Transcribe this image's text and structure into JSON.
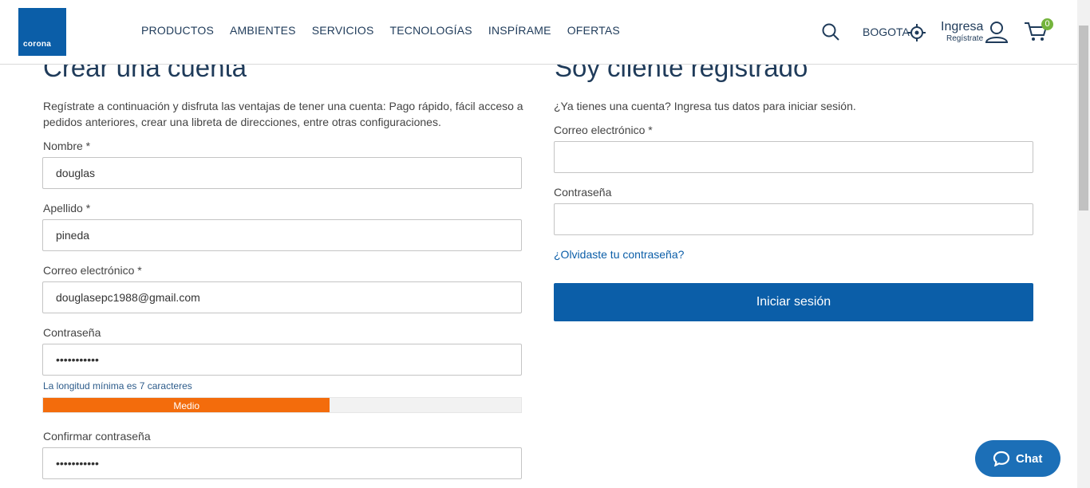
{
  "header": {
    "logo_text": "corona",
    "nav": [
      "PRODUCTOS",
      "AMBIENTES",
      "SERVICIOS",
      "TECNOLOGÍAS",
      "INSPÍRAME",
      "OFERTAS"
    ],
    "city": "BOGOTA",
    "login": "Ingresa",
    "register": "Regístrate",
    "cart_count": "0"
  },
  "create_account": {
    "title": "Crear una cuenta",
    "description": "Regístrate a continuación y disfruta las ventajas de tener una cuenta: Pago rápido, fácil acceso a pedidos anteriores, crear una libreta de direcciones, entre otras configuraciones.",
    "first_name_label": "Nombre *",
    "first_name_value": "douglas",
    "last_name_label": "Apellido *",
    "last_name_value": "pineda",
    "email_label": "Correo electrónico *",
    "email_value": "douglasepc1988@gmail.com",
    "password_label": "Contraseña",
    "password_value": "•••••••••••",
    "password_hint": "La longitud mínima es 7 caracteres",
    "strength_label": "Medio",
    "strength_fraction": 0.6,
    "confirm_label": "Confirmar contraseña",
    "confirm_value": "•••••••••••"
  },
  "login": {
    "title": "Soy cliente registrado",
    "description": "¿Ya tienes una cuenta? Ingresa tus datos para iniciar sesión.",
    "email_label": "Correo electrónico *",
    "email_value": "",
    "password_label": "Contraseña",
    "password_value": "",
    "forgot": "¿Olvidaste tu contraseña?",
    "submit": "Iniciar sesión"
  },
  "chat": {
    "label": "Chat"
  },
  "colors": {
    "brand": "#0b5ea8",
    "strength_medium": "#f36c0c",
    "badge": "#74b43c"
  }
}
